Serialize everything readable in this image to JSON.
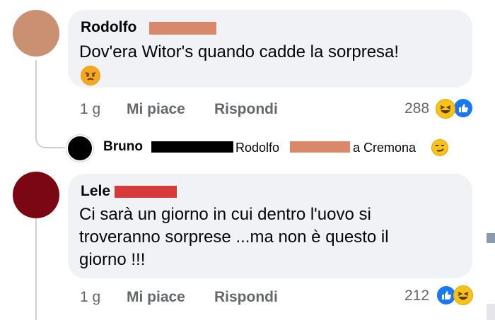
{
  "comments": [
    {
      "author": "Rodolfo",
      "text": "Dov'era Witor's quando cadde la sorpresa!",
      "time": "1 g",
      "like_label": "Mi piace",
      "reply_label": "Rispondi",
      "reaction_count": "288",
      "avatar_color": "#c99172",
      "redaction_color": "#d9896a"
    },
    {
      "author": "Lele",
      "text_lines": [
        "Ci sarà un giorno in cui dentro l'uovo si",
        "troveranno sorprese ...ma non è questo il",
        "giorno !!!"
      ],
      "time": "1 g",
      "like_label": "Mi piace",
      "reply_label": "Rispondi",
      "reaction_count": "212",
      "avatar_color": "#7a0711",
      "redaction_color": "#d63a3a"
    }
  ],
  "reply": {
    "author": "Bruno",
    "mention": "Rodolfo",
    "suffix": "a Cremona"
  },
  "colors": {
    "bubble": "#f0f2f5",
    "meta_text": "#65676b",
    "like_blue": "#1877f2",
    "thread_line": "#ccd0d5"
  },
  "icons": [
    "angry-emoji-icon",
    "laughing-emoji-icon",
    "like-icon",
    "smirk-emoji-icon"
  ]
}
